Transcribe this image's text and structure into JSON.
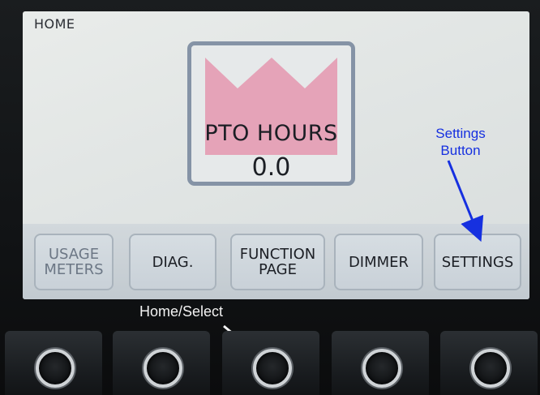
{
  "screen": {
    "page_label": "HOME",
    "pto": {
      "title": "PTO HOURS",
      "value": "0.0"
    }
  },
  "soft_buttons": [
    {
      "label": "USAGE\nMETERS",
      "dimmed": true
    },
    {
      "label": "DIAG.",
      "dimmed": false
    },
    {
      "label": "FUNCTION\nPAGE",
      "dimmed": false
    },
    {
      "label": "DIMMER",
      "dimmed": false
    },
    {
      "label": "SETTINGS",
      "dimmed": false
    }
  ],
  "annotations": {
    "settings": "Settings\nButton",
    "home_select": "Home/Select"
  },
  "colors": {
    "crown": "#e5a3b8",
    "annotation_blue": "#1630e0",
    "annotation_white": "#f2f2f2"
  },
  "icons": {
    "crown": "crown-logo",
    "hardware_buttons": "round-push-button"
  }
}
